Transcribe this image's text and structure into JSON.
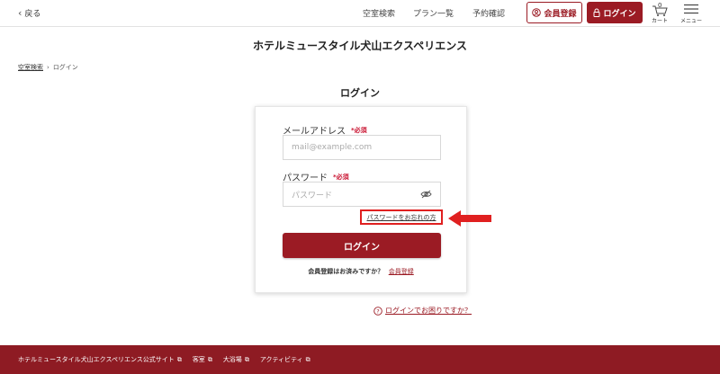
{
  "header": {
    "back_label": "戻る",
    "nav": [
      "空室検索",
      "プラン一覧",
      "予約確認"
    ],
    "register_label": "会員登録",
    "login_label": "ログイン",
    "cart_count": "0",
    "cart_label": "カート",
    "menu_label": "メニュー"
  },
  "hotel_title": "ホテルミュースタイル犬山エクスペリエンス",
  "breadcrumb": {
    "home": "空室検索",
    "current": "ログイン"
  },
  "page_title": "ログイン",
  "form": {
    "email_label": "メールアドレス",
    "email_required": "*必須",
    "email_placeholder": "mail@example.com",
    "password_label": "パスワード",
    "password_required": "*必須",
    "password_placeholder": "パスワード",
    "forgot_label": "パスワードをお忘れの方",
    "submit_label": "ログイン",
    "register_prompt": "会員登録はお済みですか？",
    "register_link": "会員登録"
  },
  "help_label": "ログインでお困りですか？",
  "footer": {
    "links": [
      "ホテルミュースタイル犬山エクスペリエンス公式サイト",
      "客室",
      "大浴場",
      "アクティビティ"
    ]
  },
  "colors": {
    "brand": "#9b1b24",
    "highlight": "#e02020",
    "footer": "#8e1b23"
  }
}
